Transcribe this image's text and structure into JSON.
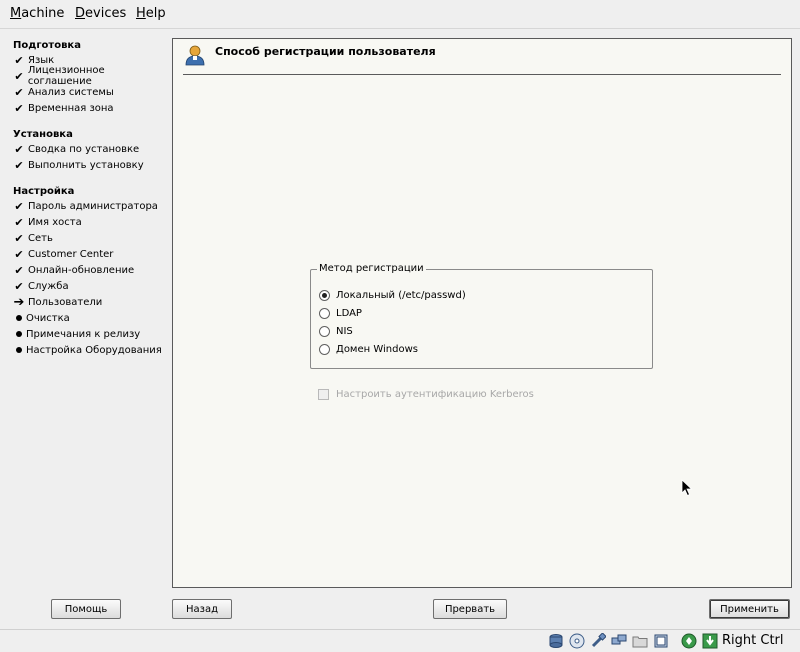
{
  "menubar": {
    "items": [
      {
        "first": "M",
        "rest": "achine"
      },
      {
        "first": "D",
        "rest": "evices"
      },
      {
        "first": "H",
        "rest": "elp"
      }
    ]
  },
  "sidebar": {
    "sections": [
      {
        "title": "Подготовка",
        "steps": [
          "Язык",
          "Лицензионное соглашение",
          "Анализ системы",
          "Временная зона"
        ]
      },
      {
        "title": "Установка",
        "steps": [
          "Сводка по установке",
          "Выполнить установку"
        ]
      },
      {
        "title": "Настройка",
        "steps": [
          "Пароль администратора",
          "Имя хоста",
          "Сеть",
          "Customer Center",
          "Онлайн-обновление",
          "Служба",
          "Пользователи",
          "Очистка",
          "Примечания к релизу",
          "Настройка Оборудования"
        ]
      }
    ]
  },
  "content": {
    "title": "Способ регистрации пользователя",
    "group_label": "Метод регистрации",
    "options": [
      {
        "label": "Локальный (/etc/passwd)",
        "checked": true
      },
      {
        "label": "LDAP",
        "checked": false
      },
      {
        "label": "NIS",
        "checked": false
      },
      {
        "label": "Домен Windows",
        "checked": false
      }
    ],
    "kerberos_label": "Настроить аутентификацию Kerberos"
  },
  "buttons": {
    "help": "Помощь",
    "back": "Назад",
    "abort": "Прервать",
    "apply": "Применить"
  },
  "statusbar": {
    "hostkey": "Right Ctrl",
    "icons": [
      "hard-disk-icon",
      "optical-drive-icon",
      "usb-icon",
      "network-icon",
      "shared-folder-icon",
      "display-icon",
      "mouse-integration-icon",
      "host-key-icon"
    ]
  }
}
